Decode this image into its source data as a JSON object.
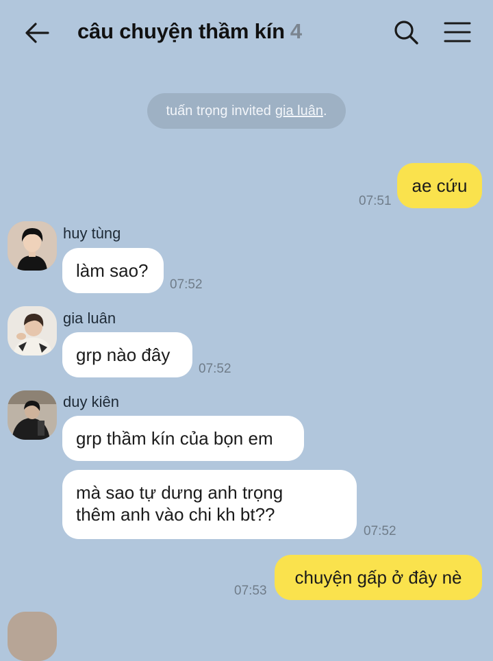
{
  "header": {
    "title": "câu chuyện thầm kín",
    "member_count": "4",
    "back_icon": "arrow-left-icon",
    "search_icon": "search-icon",
    "menu_icon": "hamburger-menu-icon"
  },
  "notice": {
    "prefix": "tuấn trọng invited",
    "link": "gia luân",
    "suffix": "."
  },
  "messages": [
    {
      "sender": "",
      "text": "ae cứu",
      "time": "07:51",
      "own": true
    },
    {
      "sender": "huy tùng",
      "text": "làm sao?",
      "time": "07:52",
      "own": false
    },
    {
      "sender": "gia luân",
      "text": "grp nào đây",
      "time": "07:52",
      "own": false
    },
    {
      "sender": "duy kiên",
      "text": "grp thầm kín của bọn em",
      "time": "",
      "own": false
    },
    {
      "sender": "",
      "text": "mà sao tự dưng anh trọng thêm anh vào chi kh bt??",
      "line1": "mà sao tự dưng anh trọng",
      "line2": "thêm anh vào chi kh bt??",
      "time": "07:52",
      "own": false
    },
    {
      "sender": "",
      "text": "chuyện gấp ở đây nè",
      "time": "07:53",
      "own": true
    }
  ],
  "colors": {
    "background": "#b1c6dc",
    "own_bubble": "#fae24d",
    "other_bubble": "#ffffff",
    "notice": "#9eb1c4"
  }
}
